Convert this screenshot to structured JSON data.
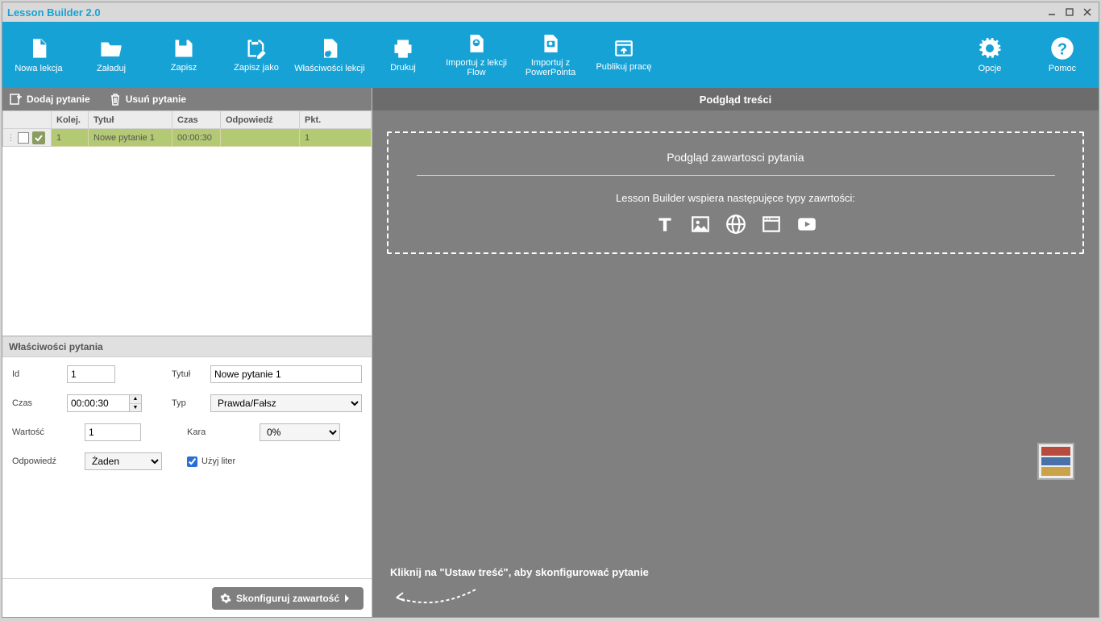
{
  "window": {
    "title": "Lesson Builder 2.0"
  },
  "toolbar": {
    "new_lesson": "Nowa lekcja",
    "load": "Załaduj",
    "save": "Zapisz",
    "save_as": "Zapisz jako",
    "lesson_props": "Właściwości lekcji",
    "print": "Drukuj",
    "import_flow": "Importuj z lekcji Flow",
    "import_ppt": "Importuj z PowerPointa",
    "publish": "Publikuj pracę",
    "options": "Opcje",
    "help": "Pomoc"
  },
  "left_toolbar": {
    "add": "Dodaj pytanie",
    "remove": "Usuń pytanie"
  },
  "table": {
    "headers": {
      "order": "Kolej.",
      "title": "Tytuł",
      "time": "Czas",
      "answer": "Odpowiedź",
      "points": "Pkt."
    },
    "row": {
      "order": "1",
      "title": "Nowe pytanie 1",
      "time": "00:00:30",
      "answer": "",
      "points": "1"
    }
  },
  "props": {
    "panel_title": "Właściwości pytania",
    "id_label": "Id",
    "id_value": "1",
    "title_label": "Tytuł",
    "title_value": "Nowe pytanie 1",
    "time_label": "Czas",
    "time_value": "00:00:30",
    "type_label": "Typ",
    "type_value": "Prawda/Fałsz",
    "value_label": "Wartość",
    "value_value": "1",
    "penalty_label": "Kara",
    "penalty_value": "0%",
    "answer_label": "Odpowiedź",
    "answer_value": "Żaden",
    "use_letters_label": "Użyj liter"
  },
  "configure_button": "Skonfiguruj zawartość",
  "right": {
    "heading": "Podgląd treści",
    "preview_title": "Podgląd zawartosci pytania",
    "support_line": "Lesson Builder wspiera następujęce typy zawrtości:",
    "hint": "Kliknij na \"Ustaw treść\", aby skonfigurować pytanie"
  }
}
